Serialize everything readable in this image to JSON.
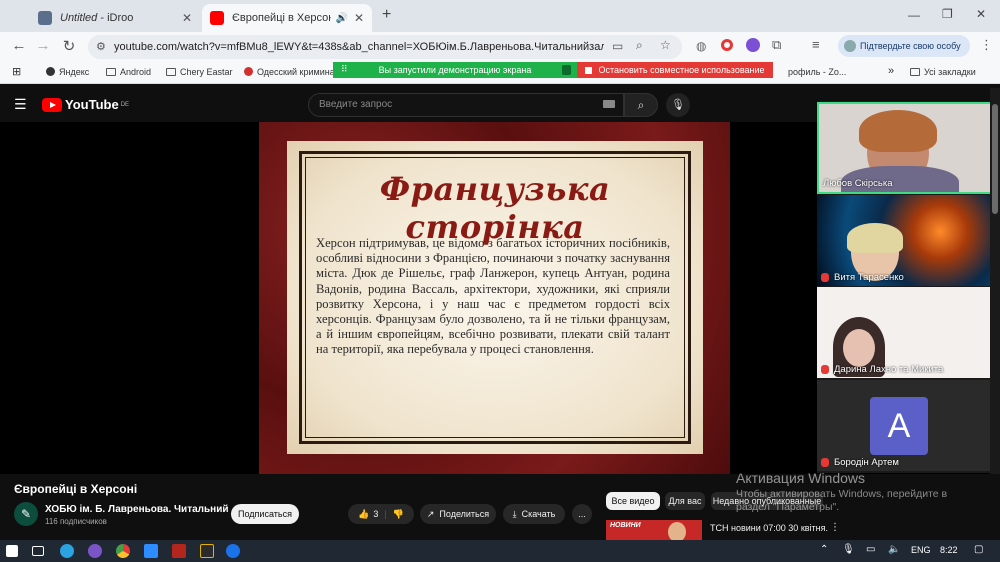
{
  "browser": {
    "tabs": [
      {
        "title": "Untitled",
        "suffix": " - iDroo",
        "active": false
      },
      {
        "title": "Європейці в Херсоні - You",
        "active": true
      }
    ],
    "new_tab_label": "+",
    "url": "youtube.com/watch?v=mfBMu8_lEWY&t=438s&ab_channel=ХОБЮім.Б.Лавреньова.Читальнийзал.",
    "profile_button": "Підтвердьте свою особу",
    "bookmarks": [
      {
        "label": "Яндекс"
      },
      {
        "label": "Android"
      },
      {
        "label": "Chery Eastar"
      },
      {
        "label": "Одесский криминал"
      },
      {
        "label": "рофиль - Zo..."
      }
    ],
    "bookmarks_more": "»",
    "all_bookmarks": "Усі закладки"
  },
  "screen_share": {
    "started": "Вы запустили демонстрацию экрана",
    "stop": "Остановить совместное использование"
  },
  "youtube": {
    "logo": "YouTube",
    "region": "DE",
    "search_placeholder": "Введите запрос",
    "video_title": "Європейці в Херсоні",
    "channel_name": "ХОБЮ ім. Б. Лавреньова. Читальний ...",
    "channel_subs": "116 подписчиков",
    "subscribe": "Подписаться",
    "likes": "3",
    "share": "Поделиться",
    "download": "Скачать",
    "more": "...",
    "chips": [
      "Все видео",
      "Для вас",
      "Недавно опубликованные"
    ],
    "rec_title": "ТСН новини 07:00 30 квітня.",
    "rec_thumb_label": "НОВИНИ"
  },
  "slide": {
    "title": "Французька сторінка",
    "text": "Херсон підтримував, це відомо з багатьох історичних посібників, особливі відносини з Францією, починаючи з початку заснування міста. Дюк де Рішельє, граф Ланжерон, купець Антуан, родина Вадонів, родина Вассаль, архітектори, художники, які сприяли розвитку Херсона, і у наш час є предметом гордості всіх херсонців. Французам було дозволено, та й не тільки французам, а й іншим європейцям, всебічно розвивати, плекати свій талант на території, яка перебувала у процесі становлення."
  },
  "participants": [
    {
      "name": "Любов Скірська",
      "muted": false
    },
    {
      "name": "Витя Тарасенко",
      "muted": true
    },
    {
      "name": "Дарина Лахно та Микита",
      "muted": true
    },
    {
      "name": "Бородін Артем",
      "muted": true,
      "initial": "A"
    }
  ],
  "windows": {
    "activation_title": "Активация Windows",
    "activation_text": "Чтобы активировать Windows, перейдите в раздел \"Параметры\".",
    "lang": "ENG",
    "time": "8:22"
  }
}
